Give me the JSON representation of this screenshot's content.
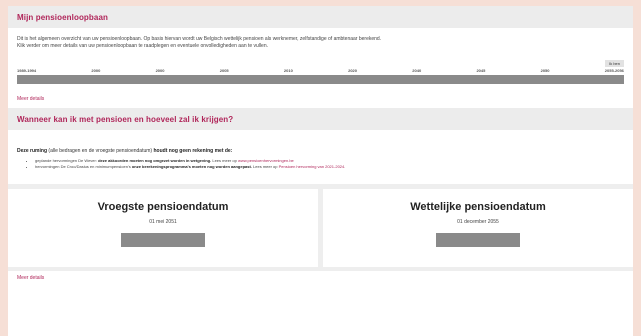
{
  "section1": {
    "title": "Mijn pensioenloopbaan",
    "intro_line1": "Dit is het algemeen overzicht van uw pensioenloopbaan. Op basis hiervan wordt uw Belgisch wettelijk pensioen als werknemer, zelfstandige of ambtenaar berekend.",
    "intro_line2": "Klik verder om meer details van uw pensioenloopbaan te raadplegen en eventuele onvolledigheden aan te vullen."
  },
  "timeline": {
    "badge": "Ik ben",
    "ticks": [
      "1989-1994",
      "2000",
      "2000",
      "2005",
      "2010",
      "2020",
      "2040",
      "2045",
      "2050",
      "2055-2056"
    ]
  },
  "more_details_1": "Meer details",
  "section2": {
    "title": "Wanneer kan ik met pensioen en hoeveel zal ik krijgen?"
  },
  "note": {
    "lead_a": "Deze ruming",
    "lead_b": "(alle bedragen en de vroegste pensioendatum)",
    "lead_c": "houdt nog geen rekening met de:",
    "bullet1_pre": "geplande hervormingen De Wever:",
    "bullet1_bold": "deze akkoorden moeten nog omgezet worden in wetgeving.",
    "bullet1_post": "Lees meer op",
    "bullet1_link": "www.pensioenhervormingen.be",
    "bullet2_pre": "hervormingen De Croo/Dasius en minimumpensioen's",
    "bullet2_bold": "onze berekeningsprogramma's moeten nog worden aangepast.",
    "bullet2_post": "Lees meer op",
    "bullet2_link": "Pensioen hervorming van 2021-2024."
  },
  "cards": [
    {
      "title": "Vroegste pensioendatum",
      "date": "01 mei 2051"
    },
    {
      "title": "Wettelijke pensioendatum",
      "date": "01 december 2055"
    }
  ],
  "more_details_2": "Meer details"
}
